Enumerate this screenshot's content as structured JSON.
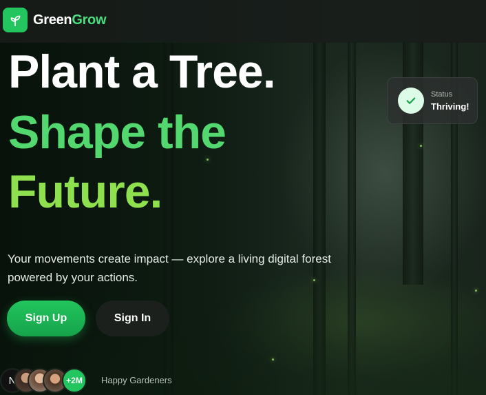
{
  "brand": {
    "name_part1": "Green",
    "name_part2": "Grow",
    "icon": "sprout-icon",
    "accent": "#22c55e"
  },
  "hero": {
    "line1": "Plant a Tree.",
    "line2": "Shape the",
    "line3": "Future.",
    "subtitle": "Your movements create impact — explore a living digital forest powered by your actions."
  },
  "actions": {
    "signup_label": "Sign Up",
    "signin_label": "Sign In"
  },
  "social_proof": {
    "initial": "N",
    "count": "+2M",
    "label": "Happy Gardeners"
  },
  "status_card": {
    "label": "Status",
    "value": "Thriving!",
    "icon": "check-icon"
  }
}
